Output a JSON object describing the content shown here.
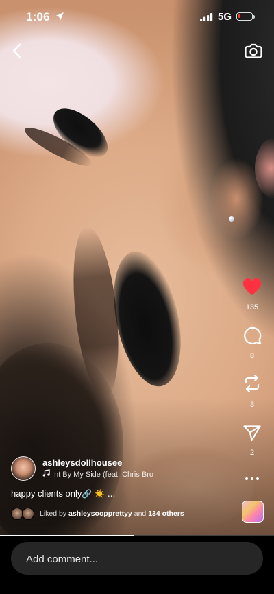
{
  "status_bar": {
    "time": "1:06",
    "network": "5G",
    "battery_level": 0.18,
    "battery_color": "#ff3b30"
  },
  "header": {
    "back_icon": "chevron-left-icon",
    "camera_icon": "camera-icon"
  },
  "actions": {
    "like": {
      "icon": "heart-filled-icon",
      "count": "135",
      "color": "#ff3040"
    },
    "comment": {
      "icon": "comment-bubble-icon",
      "count": "8"
    },
    "remix": {
      "icon": "remix-arrows-icon",
      "count": "3"
    },
    "share": {
      "icon": "paper-plane-icon",
      "count": "2"
    },
    "more": {
      "icon": "more-horizontal-icon"
    }
  },
  "post": {
    "username": "ashleysdollhousee",
    "music": "nt By My Side (feat. Chris Bro",
    "caption_text": "happy clients only",
    "caption_emoji": "🔗 ☀️ ...",
    "liked_by_prefix": "Liked by ",
    "liked_by_user": "ashleysoopprettyy",
    "liked_by_suffix": " and ",
    "liked_by_others": "134 others"
  },
  "playback": {
    "progress": 0.49
  },
  "comment_bar": {
    "placeholder": "Add comment..."
  }
}
